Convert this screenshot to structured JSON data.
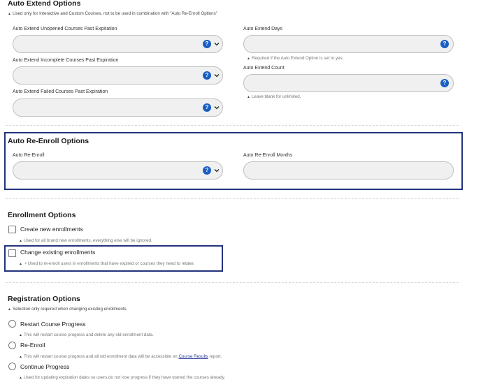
{
  "auto_extend": {
    "title": "Auto Extend Options",
    "note": "Used only for Interactive and Custom Courses, not to be used in combination with \"Auto Re-Enroll Options\"",
    "unopened_label": "Auto Extend Unopened Courses Past Expiration",
    "incomplete_label": "Auto Extend Incomplete Courses Past Expiration",
    "failed_label": "Auto Extend Failed Courses Past Expiration",
    "days_label": "Auto Extend Days",
    "days_hint": "Required if the Auto Extend Option is set to yes.",
    "count_label": "Auto Extend Count",
    "count_hint": "Leave blank for unlimited."
  },
  "auto_reenroll": {
    "title": "Auto Re-Enroll Options",
    "reenroll_label": "Auto Re-Enroll",
    "months_label": "Auto Re-Enroll Months"
  },
  "enrollment": {
    "title": "Enrollment Options",
    "create_label": "Create new enrollments",
    "create_hint": "Used for all brand new enrollments, everything else will be ignored.",
    "change_label": "Change existing enrollments",
    "change_hint": "Used to re-enroll users in enrollments that have expired or courses they need to retake."
  },
  "registration": {
    "title": "Registration Options",
    "note": "Selection only required when changing existing enrollments.",
    "restart_label": "Restart Course Progress",
    "restart_hint": "This will restart course progress and delete any old enrollment data.",
    "reenroll_label": "Re-Enroll",
    "reenroll_hint_pre": "This will restart course progress and all old enrollment data will be accessible on",
    "reenroll_hint_link": "Course Results",
    "reenroll_hint_post": "report.",
    "continue_label": "Continue Progress",
    "continue_hint": "Used for updating expiration dates so users do not lose progress if they have started the courses already."
  },
  "icons": {
    "help": "question-circle-icon",
    "chevron": "chevron-down-icon",
    "hint_marker": "caret-up-icon"
  },
  "colors": {
    "help_blue": "#1b5fc4",
    "highlight_border": "#23337e",
    "field_bg": "#f0f0f0"
  }
}
